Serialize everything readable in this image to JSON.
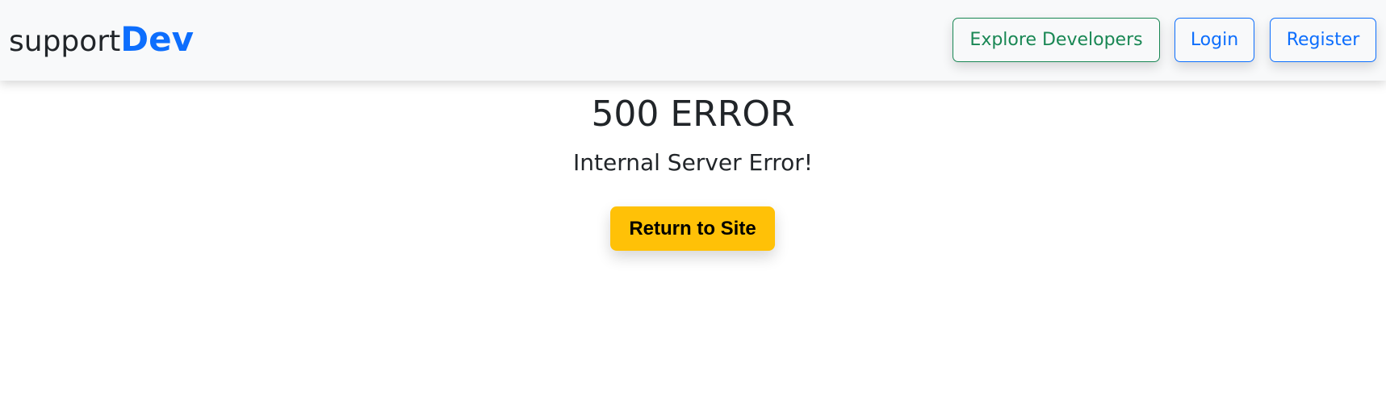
{
  "navbar": {
    "brand": {
      "prefix": "support",
      "highlight": "Dev"
    },
    "buttons": {
      "explore": "Explore Developers",
      "login": "Login",
      "register": "Register"
    }
  },
  "error": {
    "title": "500 ERROR",
    "subtitle": "Internal Server Error!",
    "return_label": "Return to Site"
  },
  "colors": {
    "brand_blue": "#0d6efd",
    "explore_green": "#198754",
    "return_yellow": "#ffc107",
    "navbar_bg": "#f8f9fa"
  }
}
